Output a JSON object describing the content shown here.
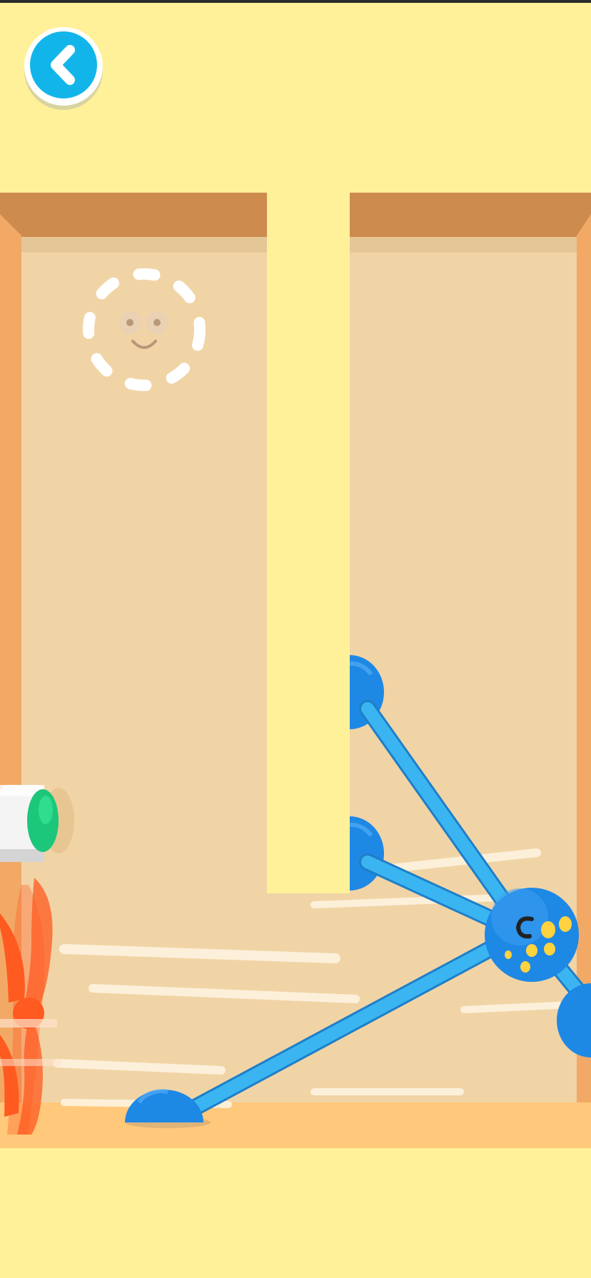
{
  "screen": {
    "name": "rope-puzzle-level"
  },
  "colors": {
    "background": "#FFF19A",
    "wall_top": "#CD8B4E",
    "wall_side": "#F2A966",
    "floor": "#F1D4A6",
    "divider": "#FFF19A",
    "rope": "#3BB5F2",
    "ball": "#1E88E5",
    "accent_button": "#12B5EA",
    "fan": "#FF5A1F",
    "cannon_tip": "#1CC67A"
  },
  "icons": {
    "back": "chevron-left-icon",
    "target": "smiley-target-icon",
    "character": "blue-smiley-ball",
    "fan": "spinning-fan",
    "cannon": "wall-cannon"
  },
  "target": {
    "style": "dashed-circle",
    "face": "smile"
  },
  "character": {
    "face": "wink"
  }
}
